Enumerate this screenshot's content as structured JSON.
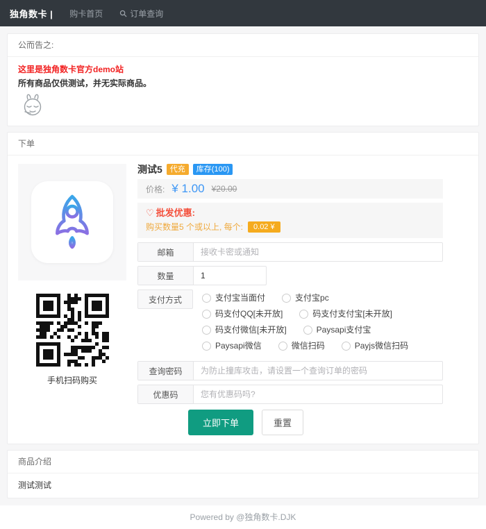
{
  "navbar": {
    "brand": "独角数卡 |",
    "links": [
      {
        "label": "购卡首页"
      },
      {
        "label": "订单查询"
      }
    ]
  },
  "announcement": {
    "title": "公而告之:",
    "line1": "这里是独角数卡官方demo站",
    "line2": "所有商品仅供测试，并无实际商品。"
  },
  "order": {
    "title": "下单",
    "product": {
      "name": "测试5",
      "badges": [
        {
          "label": "代充",
          "color": "#f5ab2e"
        },
        {
          "label": "库存(100)",
          "color": "#2a97f3"
        }
      ],
      "price_label": "价格:",
      "price": "¥ 1.00",
      "original_price": "¥20.00",
      "wholesale": {
        "icon": "♡",
        "title": "批发优惠:",
        "desc": "购买数量5 个或以上, 每个:",
        "unit_price": "0.02 ¥"
      },
      "qr_caption": "手机扫码购买"
    },
    "form": {
      "email_label": "邮箱",
      "email_placeholder": "接收卡密或通知",
      "quantity_label": "数量",
      "quantity_value": "1",
      "payment_label": "支付方式",
      "payments": [
        "支付宝当面付",
        "支付宝pc",
        "码支付QQ[未开放]",
        "码支付支付宝[未开放]",
        "码支付微信[未开放]",
        "Paysapi支付宝",
        "Paysapi微信",
        "微信扫码",
        "Payjs微信扫码"
      ],
      "query_password_label": "查询密码",
      "query_password_placeholder": "为防止撞库攻击，请设置一个查询订单的密码",
      "coupon_label": "优惠码",
      "coupon_placeholder": "您有优惠码吗?",
      "submit_label": "立即下单",
      "reset_label": "重置"
    }
  },
  "description": {
    "title": "商品介绍",
    "body": "测试测试"
  },
  "footer": {
    "text": "Powered by @独角数卡.DJK"
  },
  "colors": {
    "navbar_bg": "#32383e",
    "accent_green": "#109c81",
    "price_blue": "#3e97f5",
    "type_badge_orange": "#f5ab2e",
    "stock_badge_blue": "#2a97f3",
    "wholesale_red": "#f4503c",
    "wholesale_orange": "#efa93d",
    "announcement_red": "#f22222",
    "rocket_gradient_top": "#3aa7e9",
    "rocket_gradient_bottom": "#8b6fe3"
  }
}
